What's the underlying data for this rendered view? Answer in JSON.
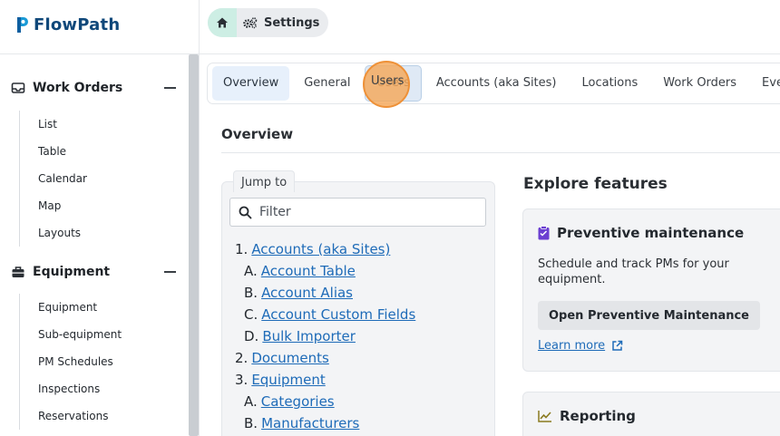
{
  "app": {
    "name": "FlowPath"
  },
  "breadcrumb": {
    "settings_label": "Settings"
  },
  "sidebar": {
    "work_orders": {
      "label": "Work Orders",
      "items": [
        "List",
        "Table",
        "Calendar",
        "Map",
        "Layouts"
      ]
    },
    "equipment": {
      "label": "Equipment",
      "items": [
        "Equipment",
        "Sub-equipment",
        "PM Schedules",
        "Inspections",
        "Reservations"
      ]
    }
  },
  "tabs": [
    "Overview",
    "General",
    "Users",
    "Accounts (aka Sites)",
    "Locations",
    "Work Orders",
    "Event"
  ],
  "page": {
    "title": "Overview"
  },
  "jump": {
    "tag": "Jump to",
    "filter_placeholder": "Filter",
    "toc": [
      {
        "num": "1.",
        "text": "Accounts (aka Sites)"
      },
      {
        "num": "A.",
        "text": "Account Table"
      },
      {
        "num": "B.",
        "text": "Account Alias"
      },
      {
        "num": "C.",
        "text": "Account Custom Fields"
      },
      {
        "num": "D.",
        "text": "Bulk Importer"
      },
      {
        "num": "2.",
        "text": "Documents"
      },
      {
        "num": "3.",
        "text": "Equipment"
      },
      {
        "num": "A.",
        "text": "Categories"
      },
      {
        "num": "B.",
        "text": "Manufacturers"
      }
    ]
  },
  "explore": {
    "title": "Explore features",
    "pm": {
      "title": "Preventive maintenance",
      "desc": "Schedule and track PMs for your equipment.",
      "button": "Open Preventive Maintenance",
      "link": "Learn more"
    },
    "reporting": {
      "title": "Reporting"
    }
  },
  "colors": {
    "accent": "#1e6bb8",
    "brand": "#10487a",
    "pm_icon": "#6b3fd1",
    "reporting_icon": "#8a7a1f",
    "click_marker": "#f5a85a"
  }
}
